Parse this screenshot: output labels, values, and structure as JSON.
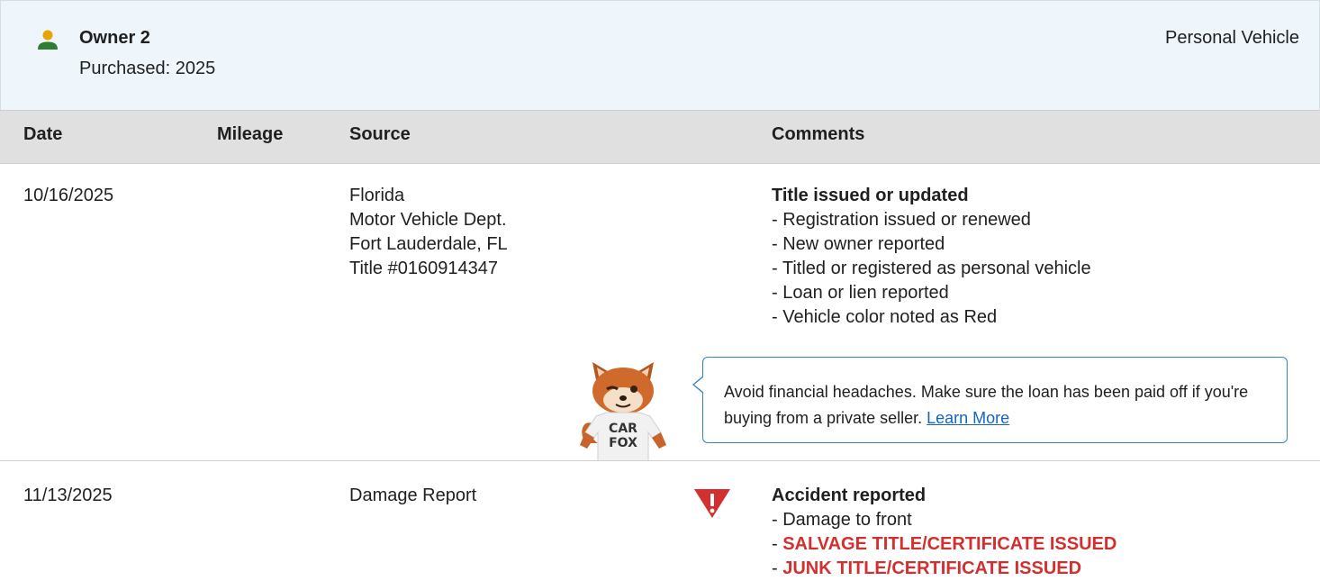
{
  "owner": {
    "name": "Owner 2",
    "purchased": "Purchased: 2025",
    "vehicle_type": "Personal Vehicle",
    "icon": "person-icon",
    "icon_color": "#2e7d32"
  },
  "table": {
    "headers": [
      "Date",
      "Mileage",
      "Source",
      "Comments"
    ]
  },
  "records": [
    {
      "date": "10/16/2025",
      "mileage": "",
      "source": [
        "Florida",
        "Motor Vehicle Dept.",
        "Fort Lauderdale, FL",
        "Title #0160914347"
      ],
      "comment_title": "Title issued or updated",
      "comments": [
        "- Registration issued or renewed",
        "- New owner reported",
        "- Titled or registered as personal vehicle",
        "- Loan or lien reported",
        "- Vehicle color noted as Red"
      ]
    },
    {
      "date": "11/13/2025",
      "mileage": "",
      "source": [
        "Damage Report"
      ],
      "comment_title": "Accident reported",
      "comments": [
        "- Damage to front"
      ],
      "alert_comments": [
        "SALVAGE TITLE/CERTIFICATE ISSUED",
        "JUNK TITLE/CERTIFICATE ISSUED"
      ],
      "alert_icon": "warning-triangle-icon",
      "alert_color": "#d32f2f"
    }
  ],
  "tip": {
    "text": "Avoid financial headaches. Make sure the loan has been paid off if you're buying from a private seller.",
    "link_label": "Learn More",
    "mascot_label": "CAR FOX",
    "border_color": "#3b82c4",
    "link_color": "#1565c0"
  }
}
